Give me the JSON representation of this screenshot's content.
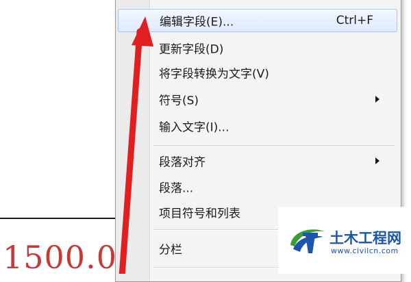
{
  "document": {
    "visible_value_fragment": "1500.0"
  },
  "context_menu": {
    "items": [
      {
        "id": "edit-field",
        "label": "编辑字段(E)...",
        "shortcut": "Ctrl+F",
        "has_submenu": false,
        "highlighted": true
      },
      {
        "id": "update-field",
        "label": "更新字段(D)",
        "shortcut": "",
        "has_submenu": false,
        "highlighted": false
      },
      {
        "id": "convert-field-to-text",
        "label": "将字段转换为文字(V)",
        "shortcut": "",
        "has_submenu": false,
        "highlighted": false
      },
      {
        "id": "symbol",
        "label": "符号(S)",
        "shortcut": "",
        "has_submenu": true,
        "highlighted": false
      },
      {
        "id": "input-text",
        "label": "输入文字(I)...",
        "shortcut": "",
        "has_submenu": false,
        "highlighted": false
      },
      {
        "id": "paragraph-align",
        "label": "段落对齐",
        "shortcut": "",
        "has_submenu": true,
        "highlighted": false
      },
      {
        "id": "paragraph",
        "label": "段落...",
        "shortcut": "",
        "has_submenu": false,
        "highlighted": false
      },
      {
        "id": "bullets-and-numbering",
        "label": "项目符号和列表",
        "shortcut": "",
        "has_submenu": false,
        "highlighted": false
      },
      {
        "id": "columns",
        "label": "分栏",
        "shortcut": "",
        "has_submenu": false,
        "highlighted": false
      }
    ]
  },
  "watermark": {
    "title": "土木工程网",
    "url": "www.civilcn.com"
  },
  "colors": {
    "arrow_red": "#e02020",
    "value_red": "#c33a3a",
    "highlight_border": "#a9c5ee",
    "brand_blue": "#1d55a8",
    "brand_green": "#3f9a3a"
  }
}
